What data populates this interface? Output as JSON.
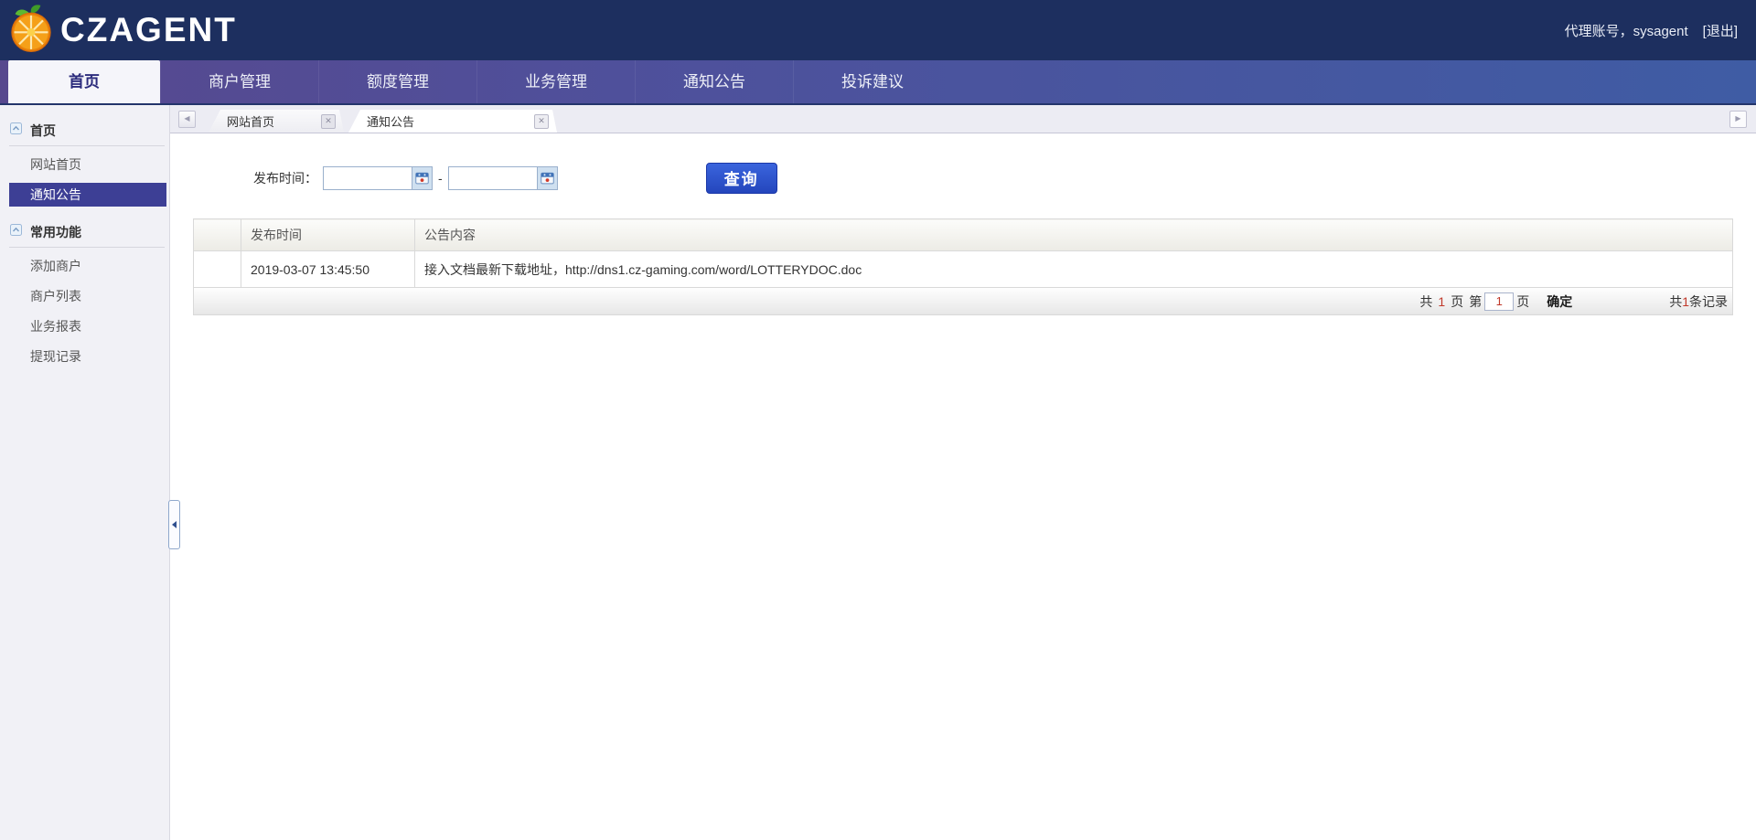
{
  "header": {
    "logo_text": "CZAGENT",
    "account_label": "代理账号，sysagent",
    "logout_label": "[退出]"
  },
  "nav": {
    "items": [
      {
        "label": "首页",
        "active": true
      },
      {
        "label": "商户管理",
        "active": false
      },
      {
        "label": "额度管理",
        "active": false
      },
      {
        "label": "业务管理",
        "active": false
      },
      {
        "label": "通知公告",
        "active": false
      },
      {
        "label": "投诉建议",
        "active": false
      }
    ]
  },
  "sidebar": {
    "groups": [
      {
        "label": "首页",
        "items": [
          {
            "label": "网站首页",
            "selected": false
          },
          {
            "label": "通知公告",
            "selected": true
          }
        ]
      },
      {
        "label": "常用功能",
        "items": [
          {
            "label": "添加商户",
            "selected": false
          },
          {
            "label": "商户列表",
            "selected": false
          },
          {
            "label": "业务报表",
            "selected": false
          },
          {
            "label": "提现记录",
            "selected": false
          }
        ]
      }
    ]
  },
  "tabs": {
    "items": [
      {
        "label": "网站首页",
        "active": false
      },
      {
        "label": "通知公告",
        "active": true
      }
    ]
  },
  "search_form": {
    "label": "发布时间：",
    "date_from": "",
    "date_to": "",
    "separator": "-",
    "submit_label": "查询"
  },
  "table": {
    "columns": [
      "",
      "发布时间",
      "公告内容"
    ],
    "rows": [
      {
        "time": "2019-03-07 13:45:50",
        "content": "接入文档最新下载地址，http://dns1.cz-gaming.com/word/LOTTERYDOC.doc"
      }
    ]
  },
  "pagination": {
    "label_total_prefix": "共",
    "total_pages": "1",
    "label_total_suffix": "页",
    "label_page_prefix": "第",
    "current_page": "1",
    "label_page_suffix": "页",
    "confirm_label": "确定",
    "records_prefix": "共",
    "records_count": "1",
    "records_suffix": "条记录"
  },
  "colors": {
    "header_bg": "#1d2f5f",
    "nav_gradient_left": "#57488e",
    "nav_gradient_right": "#3f5ca4",
    "sidebar_selected_bg": "#3d3f95",
    "query_button_blue": "#2a50c8",
    "pagination_number_red": "#c0392b"
  }
}
